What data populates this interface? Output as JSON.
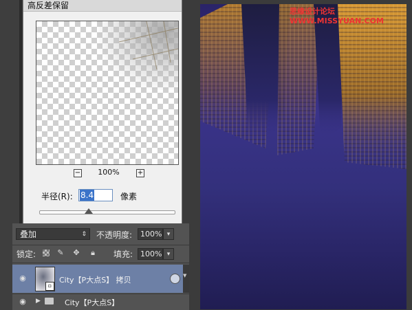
{
  "dialog": {
    "title": "高反差保留",
    "zoom_percent": "100%",
    "zoom_out_symbol": "−",
    "zoom_in_symbol": "+",
    "radius_label": "半径(R):",
    "radius_value": "8.4",
    "radius_unit": "像素"
  },
  "layers": {
    "blend_mode": "叠加",
    "opacity_label": "不透明度:",
    "opacity_value": "100%",
    "lock_label": "锁定:",
    "fill_label": "填充:",
    "fill_value": "100%",
    "items": [
      {
        "name": "City【P大点S】 拷贝",
        "selected": true,
        "visible": true,
        "clipped": true
      },
      {
        "name": "City【P大点S】",
        "type": "group",
        "visible": true
      }
    ]
  },
  "canvas": {
    "watermark": "思缘设计论坛 WWW.MISSYUAN.COM"
  },
  "colors": {
    "selected_layer": "#6d80a6",
    "canvas_sky": "#3a3389",
    "building_gold": "#c98a2a"
  }
}
